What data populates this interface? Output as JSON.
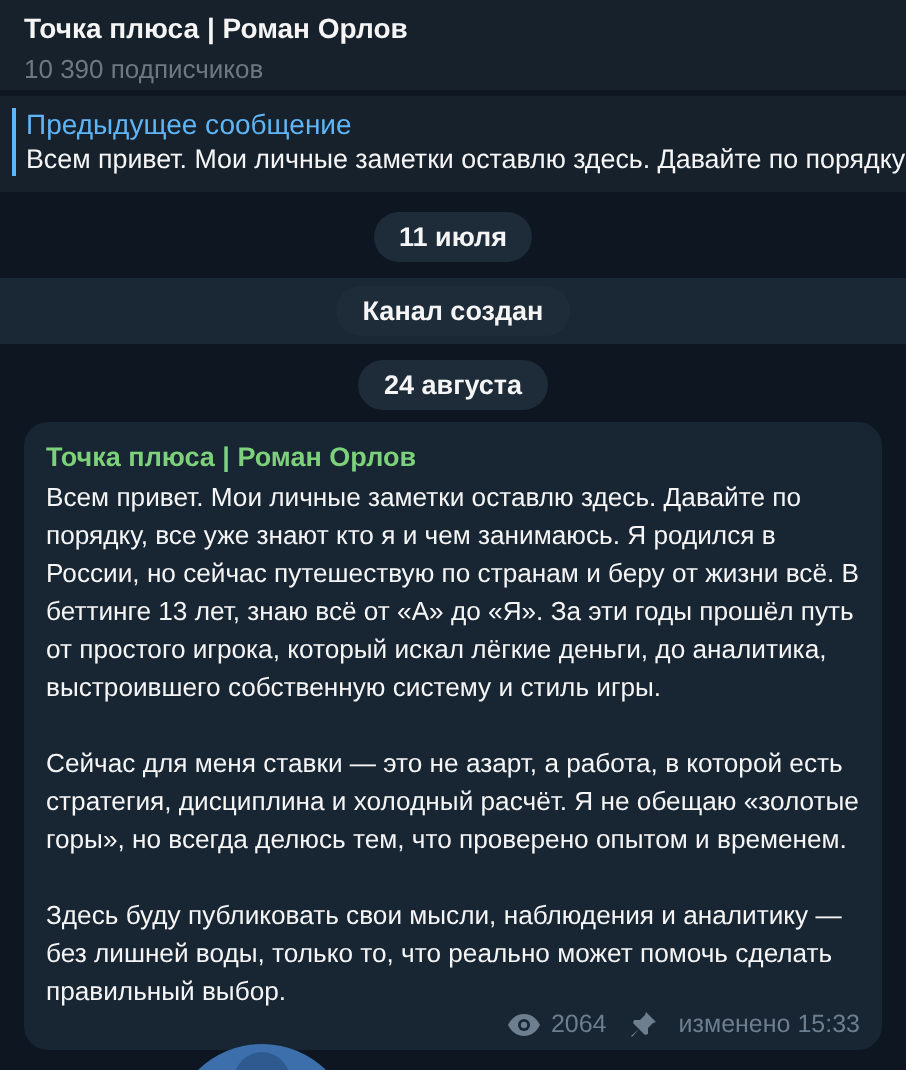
{
  "header": {
    "title": "Точка плюса | Роман Орлов",
    "subtitle": "10 390 подписчиков"
  },
  "pinned": {
    "title": "Предыдущее сообщение",
    "text": "Всем привет. Мои личные заметки оставлю здесь. Давайте по порядку"
  },
  "timeline": [
    {
      "text": "11 июля",
      "highlighted": false
    },
    {
      "text": "Канал создан",
      "highlighted": true
    },
    {
      "text": "24 августа",
      "highlighted": false
    }
  ],
  "message": {
    "author": "Точка плюса | Роман Орлов",
    "paragraphs": [
      "Всем привет. Мои личные заметки оставлю здесь. Давайте по порядку, все уже знают кто я и чем занимаюсь. Я родился в России, но сейчас путешествую по странам и беру от жизни всё. В беттинге 13 лет, знаю всё от «А» до «Я». За эти годы прошёл путь от простого игрока, который искал лёгкие деньги, до аналитика, выстроившего собственную систему и стиль игры.",
      "Сейчас для меня ставки — это не азарт, а работа, в которой есть стратегия, дисциплина и холодный расчёт. Я не обещаю «золотые горы», но всегда делюсь тем, что проверено опытом и временем.",
      "Здесь буду публиковать свои мысли, наблюдения и аналитику — без лишней воды, только то, что реально может помочь сделать правильный выбор."
    ],
    "views": "2064",
    "pinned": true,
    "edited": "изменено 15:33"
  }
}
